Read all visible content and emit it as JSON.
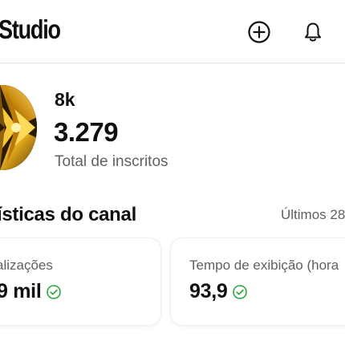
{
  "header": {
    "app_title": "Studio",
    "icons": [
      "add-circle-icon",
      "bell-icon"
    ]
  },
  "channel": {
    "name": "8k",
    "subscribers": "3.279",
    "subscribers_label": "Total de inscritos"
  },
  "analytics": {
    "title": "ísticas do canal",
    "period": "Últimos 28",
    "cards": [
      {
        "label": "alizações",
        "value": "9 mil",
        "status_icon": "check-circle-icon"
      },
      {
        "label": "Tempo de exibição (hora",
        "value": "93,9",
        "status_icon": "check-circle-icon"
      }
    ]
  },
  "colors": {
    "text_primary": "#0f0f0f",
    "text_secondary": "#606060",
    "check_green": "#2ba640",
    "divider": "#e5e5e5"
  }
}
